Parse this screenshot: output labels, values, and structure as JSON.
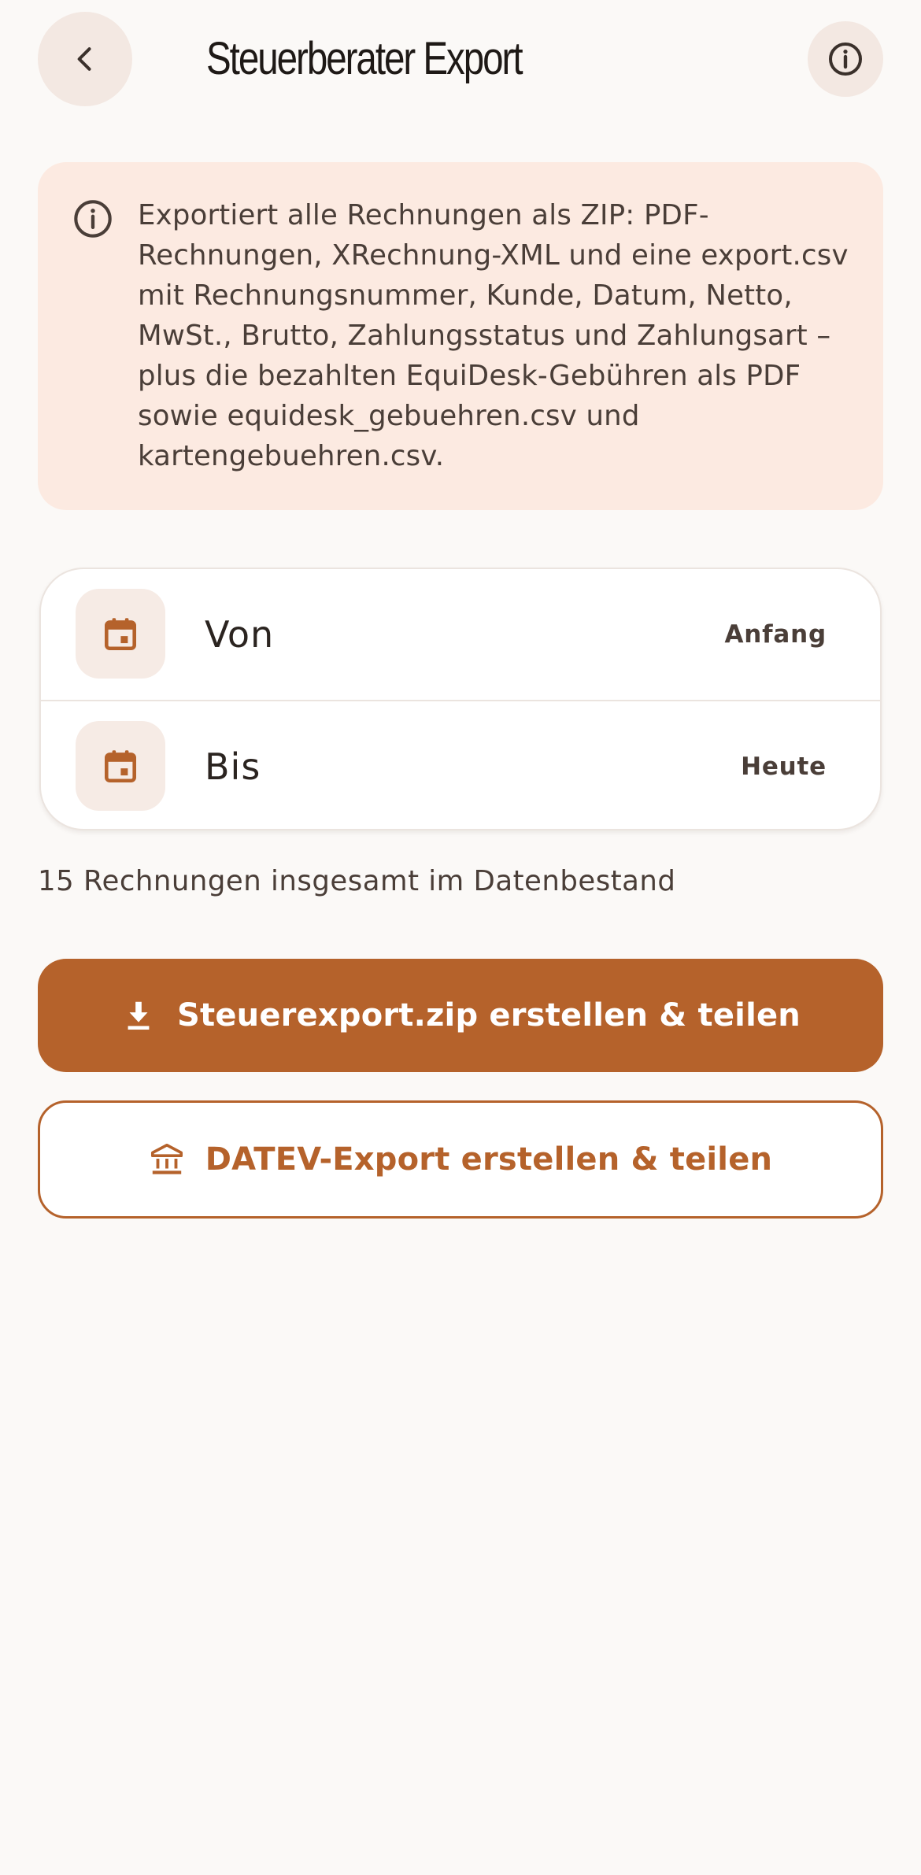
{
  "header": {
    "title": "Steuerberater Export",
    "back_icon": "chevron-left-icon",
    "info_icon": "info-icon"
  },
  "info_card": {
    "icon": "info-icon",
    "text": "Exportiert alle Rechnungen als ZIP: PDF-Rechnungen, XRechnung-XML und eine export.csv mit Rechnungsnummer, Kunde, Datum, Netto, MwSt., Brutto, Zahlungsstatus und Zahlungsart – plus die bezahlten EquiDesk-Gebühren als PDF sowie equidesk_gebuehren.csv und kartengebuehren.csv."
  },
  "date_range": {
    "from": {
      "label": "Von",
      "value": "Anfang",
      "icon": "calendar-icon"
    },
    "to": {
      "label": "Bis",
      "value": "Heute",
      "icon": "calendar-icon"
    }
  },
  "count_text": "15 Rechnungen insgesamt im Datenbestand",
  "actions": {
    "zip": {
      "label": "Steuerexport.zip erstellen & teilen",
      "icon": "download-icon"
    },
    "datev": {
      "label": "DATEV-Export erstellen & teilen",
      "icon": "bank-icon"
    }
  },
  "colors": {
    "background": "#FBF9F7",
    "accent": "#B5622B",
    "info_card_bg": "#FCEAE1",
    "icon_bg": "#F3E8E2"
  }
}
